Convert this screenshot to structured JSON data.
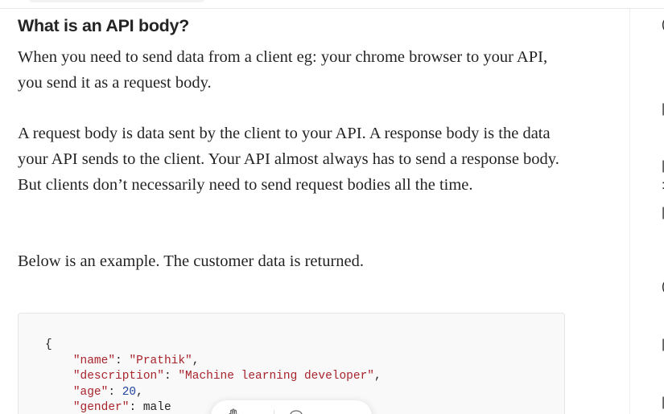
{
  "article": {
    "heading": "What is an API body?",
    "paragraphs": [
      "When you need to send data from a client eg: your chrome browser to your API, you send it as a request body.",
      "A request body is data sent by the client to your API. A response body is the data your API sends to the client. Your API almost always has to send a response body. But clients don’t necessarily need to send request bodies all the time.",
      "Below is an example. The customer data is returned."
    ],
    "code": {
      "open_brace": "{",
      "fields": [
        {
          "key": "\"name\"",
          "value": "\"Prathik\"",
          "value_type": "string",
          "trailing": ","
        },
        {
          "key": "\"description\"",
          "value": "\"Machine learning developer\"",
          "value_type": "string",
          "trailing": ","
        },
        {
          "key": "\"age\"",
          "value": "20",
          "value_type": "number",
          "trailing": ","
        },
        {
          "key": "\"gender\"",
          "value": "male",
          "value_type": "plain",
          "trailing": ""
        }
      ]
    }
  },
  "engagement": {
    "clap_icon": "clap-icon",
    "clap_count": "",
    "comment_icon": "comment-icon",
    "comment_count": ""
  },
  "colors": {
    "text": "#242424",
    "code_key": "#a8242c",
    "code_number": "#1f45a0",
    "code_bg": "#f9f9f9"
  }
}
